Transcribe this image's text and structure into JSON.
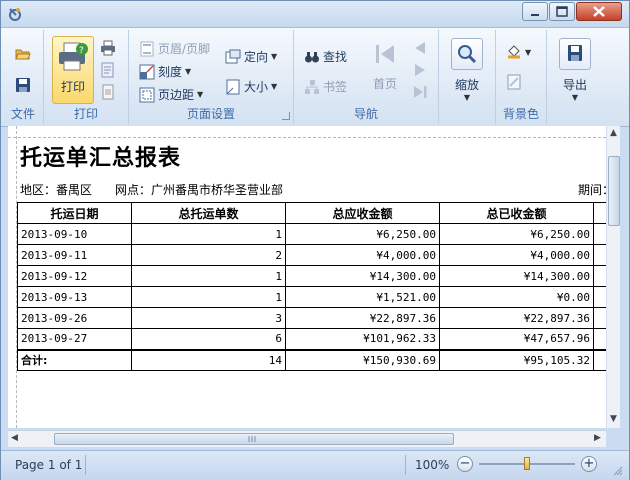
{
  "window": {
    "controls": {
      "minimize": "minimize",
      "maximize": "maximize",
      "close": "close"
    }
  },
  "ribbon": {
    "file": {
      "open_icon": "folder-open-icon",
      "save_icon": "save-icon",
      "group_label": "文件"
    },
    "print": {
      "print_label": "打印",
      "group_label": "打印"
    },
    "page_setup": {
      "header_footer": "页眉/页脚",
      "scale": "刻度",
      "margins": "页边距",
      "orientation": "定向",
      "size": "大小",
      "group_label": "页面设置"
    },
    "navigation": {
      "find": "查找",
      "bookmarks": "书签",
      "first_page": "首页",
      "group_label": "导航"
    },
    "zoom": {
      "zoom_label": "缩放"
    },
    "background": {
      "group_label": "背景色"
    },
    "export": {
      "export_label": "导出"
    }
  },
  "report": {
    "title": "托运单汇总报表",
    "region_label": "地区：番禺区",
    "outlet_label": "网点：广州番禺市桥华圣营业部",
    "period_label": "期间：",
    "columns": [
      "托运日期",
      "总托运单数",
      "总应收金额",
      "总已收金额"
    ],
    "rows": [
      {
        "date": "2013-09-10",
        "count": "1",
        "receivable": "¥6,250.00",
        "received": "¥6,250.00"
      },
      {
        "date": "2013-09-11",
        "count": "2",
        "receivable": "¥4,000.00",
        "received": "¥4,000.00"
      },
      {
        "date": "2013-09-12",
        "count": "1",
        "receivable": "¥14,300.00",
        "received": "¥14,300.00"
      },
      {
        "date": "2013-09-13",
        "count": "1",
        "receivable": "¥1,521.00",
        "received": "¥0.00"
      },
      {
        "date": "2013-09-26",
        "count": "3",
        "receivable": "¥22,897.36",
        "received": "¥22,897.36"
      },
      {
        "date": "2013-09-27",
        "count": "6",
        "receivable": "¥101,962.33",
        "received": "¥47,657.96"
      }
    ],
    "total": {
      "label": "合计:",
      "count": "14",
      "receivable": "¥150,930.69",
      "received": "¥95,105.32"
    }
  },
  "status": {
    "page_info": "Page 1 of 1",
    "zoom_level": "100%",
    "zoom_fraction": 0.5
  },
  "colors": {
    "accent": "#3e6aaa",
    "ribbon_bg": "#dde8f5",
    "print_highlight": "#fbe08a"
  }
}
